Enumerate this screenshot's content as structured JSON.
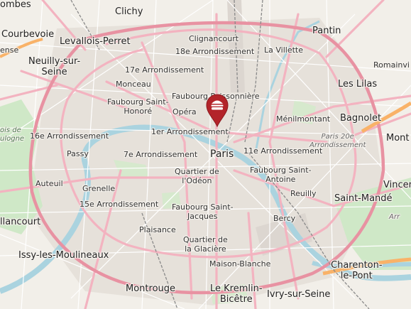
{
  "map": {
    "marker_icon": "burger-icon",
    "marker_color": "#b3242a",
    "labels": {
      "sombes": "ombes",
      "clichy": "Clichy",
      "pantin": "Pantin",
      "courbevoie": "Courbevoie",
      "levallois": "Levallois-Perret",
      "clignancourt": "Clignancourt",
      "arr18": "18e Arrondissement",
      "lavillette": "La Villette",
      "ense": "ense",
      "neuilly": "Neuilly-sur-\nSeine",
      "arr17": "17e Arrondissement",
      "romainville": "Romainvi",
      "monceau": "Monceau",
      "poissonniere": "Faubourg Poissonnière",
      "leslilas": "Les Lilas",
      "fsthonore": "Faubourg Saint-\nHonoré",
      "opera": "Opéra",
      "menilmontant": "Ménilmontant",
      "bagnolet": "Bagnolet",
      "boulogne_bois": "ois de\nulogne",
      "arr16": "16e Arrondissement",
      "arr1": "1er Arrondissement",
      "paris20": "Paris 20e\nArrondissement",
      "montreuil": "Mont",
      "passy": "Passy",
      "arr7": "7e Arrondissement",
      "paris": "Paris",
      "arr11": "11e Arrondissement",
      "odeon": "Quartier de\nl'Odéon",
      "fsantoine": "Faubourg Saint-\nAntoine",
      "vincennes": "Vincen",
      "auteuil": "Auteuil",
      "grenelle": "Grenelle",
      "reuilly": "Reuilly",
      "saintmande": "Saint-Mandé",
      "arr15": "15e Arrondissement",
      "fsjacques": "Faubourg Saint-\nJacques",
      "arr12": "Arr",
      "illancourt": "llancourt",
      "plaisance": "Plaisance",
      "bercy": "Bercy",
      "glaciere": "Quartier de\nla Glacière",
      "issy": "Issy-les-Moulineaux",
      "maisonblanche": "Maison-Blanche",
      "charenton": "Charenton-\nle-Pont",
      "montrouge": "Montrouge",
      "kremlin": "Le Kremlin-\nBicêtre",
      "ivry": "Ivry-sur-Seine"
    }
  }
}
